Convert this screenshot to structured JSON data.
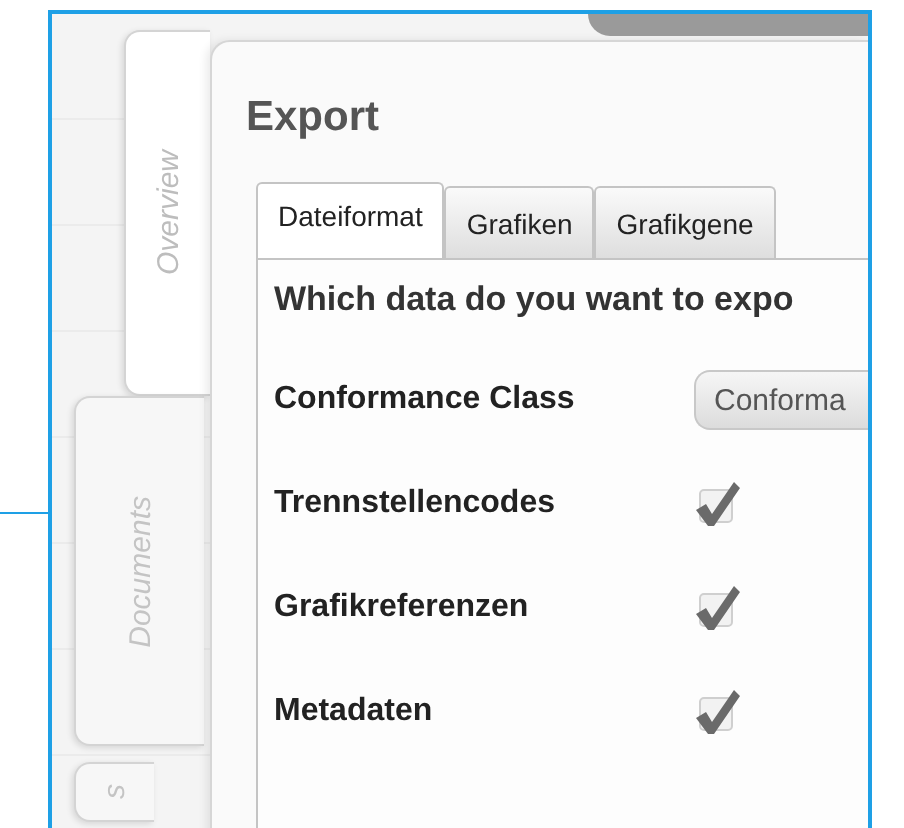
{
  "side_tabs": [
    {
      "label": "Overview"
    },
    {
      "label": "Documents"
    },
    {
      "label": "s"
    }
  ],
  "panel": {
    "title": "Export",
    "tabs": [
      {
        "label": "Dateiformat",
        "selected": true
      },
      {
        "label": "Grafiken",
        "selected": false
      },
      {
        "label": "Grafikgene",
        "selected": false
      }
    ],
    "question": "Which data do you want to expo",
    "rows": [
      {
        "kind": "dropdown",
        "label": "Conformance Class",
        "value": "Conforma"
      },
      {
        "kind": "checkbox",
        "label": "Trennstellencodes",
        "checked": true
      },
      {
        "kind": "checkbox",
        "label": "Grafikreferenzen",
        "checked": true
      },
      {
        "kind": "checkbox",
        "label": "Metadaten",
        "checked": true
      }
    ]
  }
}
